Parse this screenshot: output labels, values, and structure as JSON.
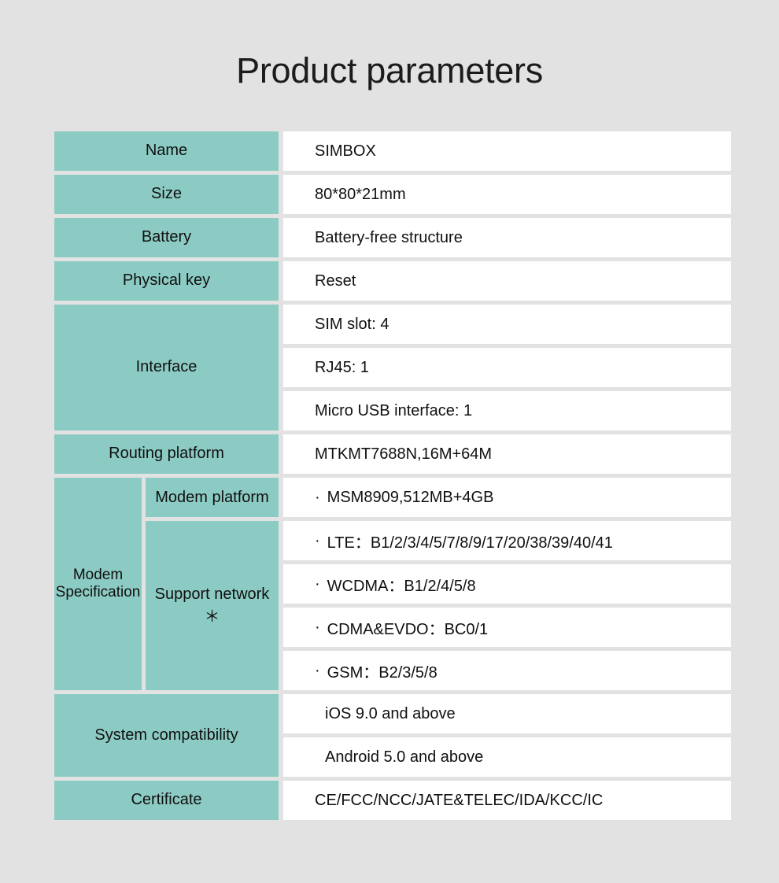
{
  "page": {
    "title": "Product parameters",
    "background_color": "#e2e2e2",
    "label_cell_color": "#8ccbc3",
    "value_cell_color": "#ffffff",
    "text_color": "#101010"
  },
  "table": {
    "simple_rows": [
      {
        "label": "Name",
        "value": "SIMBOX"
      },
      {
        "label": "Size",
        "value": "80*80*21mm"
      },
      {
        "label": "Battery",
        "value": "Battery-free structure"
      },
      {
        "label": "Physical key",
        "value": "Reset"
      }
    ],
    "interface": {
      "label": "Interface",
      "values": [
        "SIM slot: 4",
        "RJ45: 1",
        "Micro USB interface: 1"
      ]
    },
    "routing_platform": {
      "label": "Routing platform",
      "value": "MTKMT7688N,16M+64M"
    },
    "modem": {
      "label_line1": "Modem",
      "label_line2": "Specification",
      "modem_platform": {
        "label": "Modem platform",
        "bullet": "·",
        "values": [
          "MSM8909,512MB+4GB"
        ]
      },
      "support_network": {
        "label": "Support network＊",
        "bullet": "·",
        "values": [
          "LTE：B1/2/3/4/5/7/8/9/17/20/38/39/40/41",
          "WCDMA：B1/2/4/5/8",
          "CDMA&EVDO：BC0/1",
          "GSM：B2/3/5/8"
        ]
      }
    },
    "system_compatibility": {
      "label": "System compatibility",
      "values": [
        "iOS 9.0 and above",
        "Android 5.0 and above"
      ]
    },
    "certificate": {
      "label": "Certificate",
      "value": "CE/FCC/NCC/JATE&TELEC/IDA/KCC/IC"
    }
  }
}
